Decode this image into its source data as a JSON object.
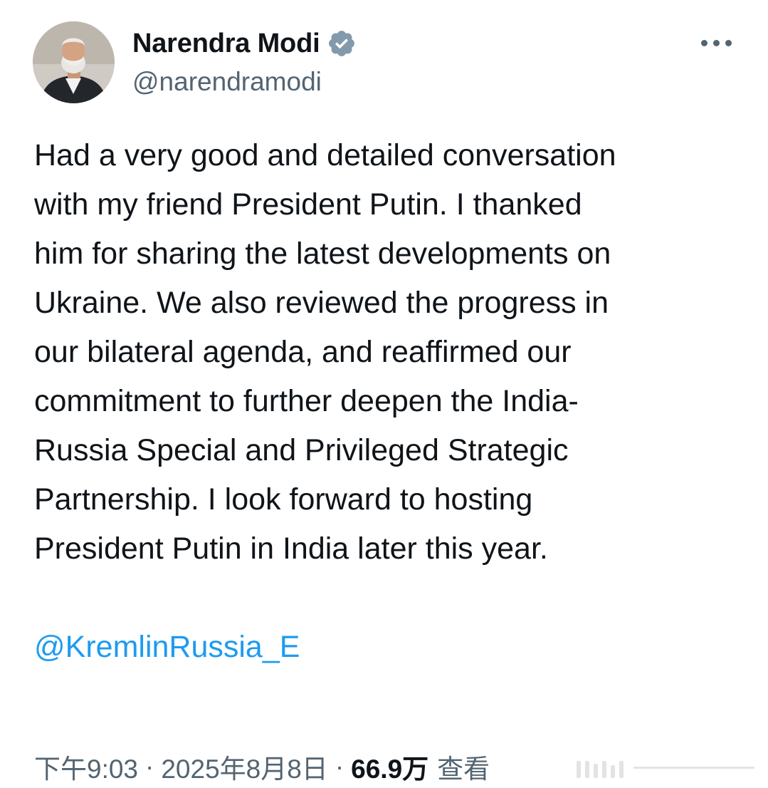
{
  "author": {
    "display_name": "Narendra Modi",
    "handle": "@narendramodi",
    "verified": true,
    "avatar_icon": "profile-photo",
    "verified_icon": "verified-badge-icon"
  },
  "menu": {
    "more_icon": "more-horizontal-icon"
  },
  "tweet": {
    "lines": [
      "Had a very good and detailed conversation",
      "with my friend President Putin. I thanked",
      "him for sharing the latest developments on",
      "Ukraine. We also reviewed the progress in",
      "our bilateral agenda, and reaffirmed our",
      "commitment to further deepen the India-",
      "Russia Special and Privileged Strategic",
      "Partnership. I look forward to hosting",
      "President Putin in India later this year."
    ],
    "mention": "@KremlinRussia_E"
  },
  "meta": {
    "time": "下午9:03",
    "separator": "·",
    "date": "2025年8月8日",
    "views_count": "66.9万",
    "views_label": "查看"
  },
  "colors": {
    "text": "#0f1419",
    "secondary": "#536471",
    "link": "#1d9bf0",
    "verified": "#829aab"
  }
}
